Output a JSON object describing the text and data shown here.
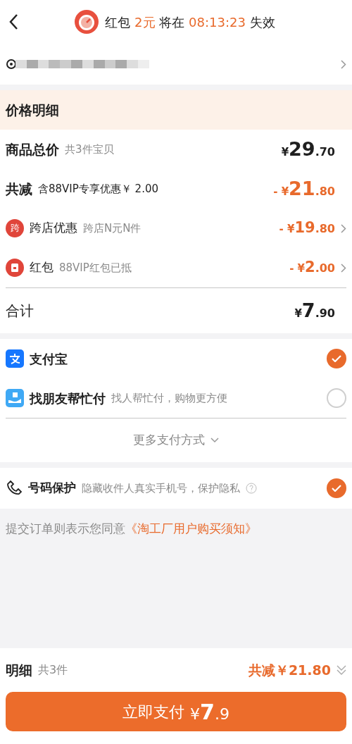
{
  "header": {
    "segments": [
      {
        "text": "红包",
        "highlight": false
      },
      {
        "text": "2元",
        "highlight": true
      },
      {
        "text": "将在",
        "highlight": false
      },
      {
        "text": "08:13:23",
        "highlight": true
      },
      {
        "text": "失效",
        "highlight": false
      }
    ]
  },
  "address": {
    "redacted": true
  },
  "price_details": {
    "title": "价格明细",
    "rows": [
      {
        "kind": "total",
        "label": "商品总价",
        "note": "共3件宝贝",
        "amount": {
          "prefix": "¥",
          "whole": "29",
          "fraction": ".70"
        },
        "arrow": false
      },
      {
        "kind": "discount",
        "label": "共减",
        "note": "含88VIP专享优惠￥ 2.00",
        "amount": {
          "prefix": "- ¥",
          "whole": "21",
          "fraction": ".80"
        },
        "arrow": false
      },
      {
        "kind": "promo",
        "icon": "跨",
        "label": "跨店优惠",
        "note": "跨店N元N件",
        "amount": {
          "prefix": "- ¥",
          "whole": "19",
          "fraction": ".80"
        },
        "arrow": true
      },
      {
        "kind": "redpacket",
        "label": "红包",
        "note": "88VIP红包已抵",
        "amount": {
          "prefix": "- ¥",
          "whole": "2",
          "fraction": ".00"
        },
        "arrow": true
      }
    ],
    "sum": {
      "label": "合计",
      "amount": {
        "prefix": "¥",
        "whole": "7",
        "fraction": ".90"
      }
    }
  },
  "payment_methods": [
    {
      "kind": "alipay",
      "label": "支付宝",
      "selected": true
    },
    {
      "kind": "friend",
      "label": "找朋友帮忙付",
      "note": "找人帮忙付，购物更方便",
      "selected": false
    }
  ],
  "more_payment": "更多支付方式",
  "number_protection": {
    "label": "号码保护",
    "note": "隐藏收件人真实手机号，保护隐私",
    "checked": true
  },
  "agreement": {
    "text": "提交订单则表示您同意",
    "link": "《淘工厂用户购买须知》"
  },
  "footer": {
    "label": "明细",
    "count": "共3件",
    "discount": "共减￥21.80",
    "pay_button": {
      "label": "立即支付",
      "prefix": "¥",
      "whole": "7",
      "fraction": ".9"
    }
  }
}
